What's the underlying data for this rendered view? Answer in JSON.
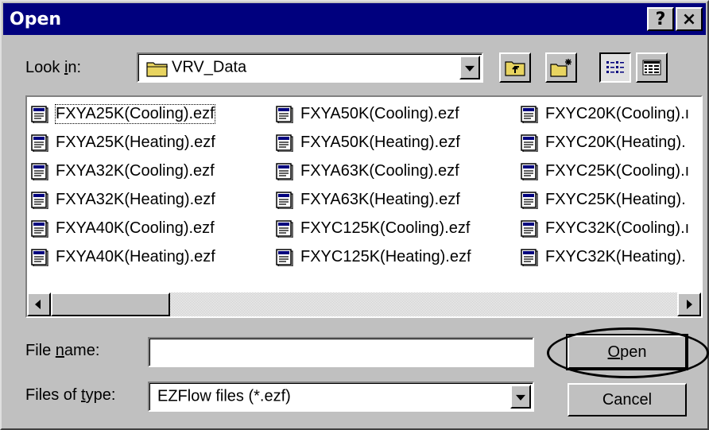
{
  "window": {
    "title": "Open",
    "help_label": "?",
    "close_label": "×"
  },
  "look_in": {
    "label_prefix": "Look ",
    "label_mnemonic": "i",
    "label_suffix": "n:",
    "value": "VRV_Data"
  },
  "toolbar": {
    "icons": [
      "up-one-level-icon",
      "create-new-folder-icon",
      "list-view-icon",
      "details-view-icon"
    ]
  },
  "files": [
    "FXYA25K(Cooling).ezf",
    "FXYA25K(Heating).ezf",
    "FXYA32K(Cooling).ezf",
    "FXYA32K(Heating).ezf",
    "FXYA40K(Cooling).ezf",
    "FXYA40K(Heating).ezf",
    "FXYA50K(Cooling).ezf",
    "FXYA50K(Heating).ezf",
    "FXYA63K(Cooling).ezf",
    "FXYA63K(Heating).ezf",
    "FXYC125K(Cooling).ezf",
    "FXYC125K(Heating).ezf",
    "FXYC20K(Cooling).ı",
    "FXYC20K(Heating).",
    "FXYC25K(Cooling).ı",
    "FXYC25K(Heating).",
    "FXYC32K(Cooling).ı",
    "FXYC32K(Heating)."
  ],
  "file_name": {
    "label_prefix": "File ",
    "label_mnemonic": "n",
    "label_suffix": "ame:",
    "value": ""
  },
  "files_of_type": {
    "label_prefix": "Files of ",
    "label_mnemonic": "t",
    "label_suffix": "ype:",
    "value": "EZFlow files (*.ezf)"
  },
  "buttons": {
    "open_mnemonic": "O",
    "open_rest": "pen",
    "cancel": "Cancel"
  },
  "colors": {
    "titlebar": "#00007e",
    "face": "#c0c0c0",
    "folder": "#e8d460"
  }
}
